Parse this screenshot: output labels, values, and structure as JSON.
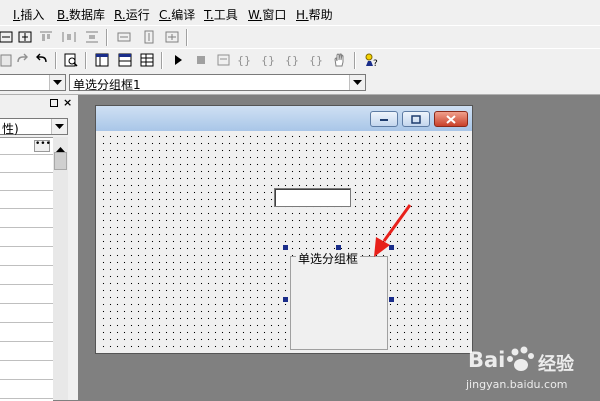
{
  "menu": {
    "items": [
      {
        "key": "I.",
        "label": "插入"
      },
      {
        "key": "B.",
        "label": "数据库"
      },
      {
        "key": "R.",
        "label": "运行"
      },
      {
        "key": "C.",
        "label": "编译"
      },
      {
        "key": "T.",
        "label": "工具"
      },
      {
        "key": "W.",
        "label": "窗口"
      },
      {
        "key": "H.",
        "label": "帮助"
      }
    ]
  },
  "control_selector": {
    "selected": "单选分组框1"
  },
  "property_panel": {
    "filter_value": "性)"
  },
  "form": {
    "groupbox_label": "单选分组框"
  },
  "watermark": {
    "brand": "Bai",
    "brand2": "经验",
    "url": "jingyan.baidu.com"
  },
  "colors": {
    "arrow": "#e8201a",
    "handle": "#1a2d8a",
    "mdi_background": "#808080"
  }
}
